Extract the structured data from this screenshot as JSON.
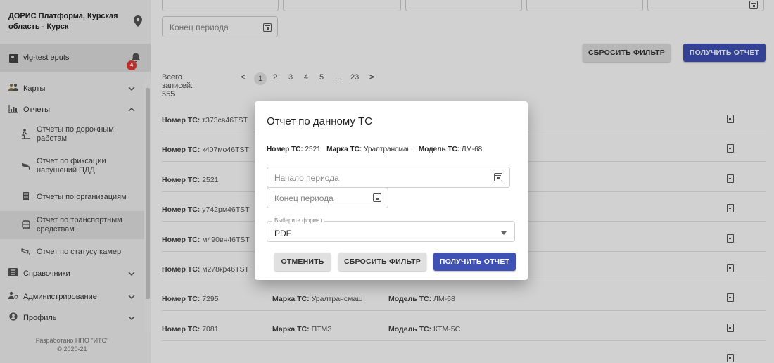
{
  "sidebar": {
    "title": "ДОРИС Платформа, Курская область - Курск",
    "user": "vlg-test eputs",
    "notif_count": "4",
    "nav": {
      "maps": "Карты",
      "reports": "Отчеты",
      "directories": "Справочники",
      "admin": "Администрирование",
      "profile": "Профиль"
    },
    "sub": {
      "road_works": "Отчеты по дорожным работам",
      "violations": "Отчет по фиксации нарушений ПДД",
      "organizations": "Отчеты по организациям",
      "vehicles": "Отчет по транспортным средствам",
      "cameras": "Отчет по статусу камер"
    },
    "footer_line1": "Разработано НПО \"ИТС\"",
    "footer_line2": "© 2020-21"
  },
  "filters": {
    "end_period_placeholder": "Конец периода",
    "reset_label": "СБРОСИТЬ ФИЛЬТР",
    "get_report_label": "ПОЛУЧИТЬ ОТЧЕТ"
  },
  "pager": {
    "total_label": "Всего записей: 555",
    "prev": "<",
    "next": ">",
    "pages": [
      "1",
      "2",
      "3",
      "4",
      "5",
      "...",
      "23"
    ]
  },
  "rows": [
    {
      "num_label": "Номер ТС:",
      "num": "т373св46TST",
      "brand_label": "",
      "brand": "",
      "model_label": "",
      "model": ""
    },
    {
      "num_label": "Номер ТС:",
      "num": "к407мо46TST",
      "brand_label": "",
      "brand": "",
      "model_label": "",
      "model": ""
    },
    {
      "num_label": "Номер ТС:",
      "num": "2521",
      "brand_label": "",
      "brand": "",
      "model_label": "",
      "model": ""
    },
    {
      "num_label": "Номер ТС:",
      "num": "у742рм46TST",
      "brand_label": "",
      "brand": "",
      "model_label": "",
      "model": ""
    },
    {
      "num_label": "Номер ТС:",
      "num": "м490вн46TST",
      "brand_label": "",
      "brand": "",
      "model_label": "",
      "model": ""
    },
    {
      "num_label": "Номер ТС:",
      "num": "м278кр46TST",
      "brand_label": "",
      "brand": "",
      "model_label": "",
      "model": ""
    },
    {
      "num_label": "Номер ТС:",
      "num": "7295",
      "brand_label": "Марка ТС:",
      "brand": "Уралтрансмаш",
      "model_label": "Модель ТС:",
      "model": "ЛМ-68"
    },
    {
      "num_label": "Номер ТС:",
      "num": "7081",
      "brand_label": "Марка ТС:",
      "brand": "ПТМЗ",
      "model_label": "Модель ТС:",
      "model": "КТМ-5С"
    }
  ],
  "dialog": {
    "title": "Отчет по данному ТС",
    "num_label": "Номер ТС:",
    "num": "2521",
    "brand_label": "Марка ТС:",
    "brand": "Уралтрансмаш",
    "model_label": "Модель ТС:",
    "model": "ЛМ-68",
    "start_placeholder": "Начало периода",
    "end_placeholder": "Конец периода",
    "format_legend": "Выберите формат",
    "format_value": "PDF",
    "cancel_label": "ОТМЕНИТЬ",
    "reset_label": "СБРОСИТЬ ФИЛЬТР",
    "get_report_label": "ПОЛУЧИТЬ ОТЧЕТ"
  },
  "colors": {
    "accent": "#3f51b5",
    "badge": "#e53935"
  }
}
